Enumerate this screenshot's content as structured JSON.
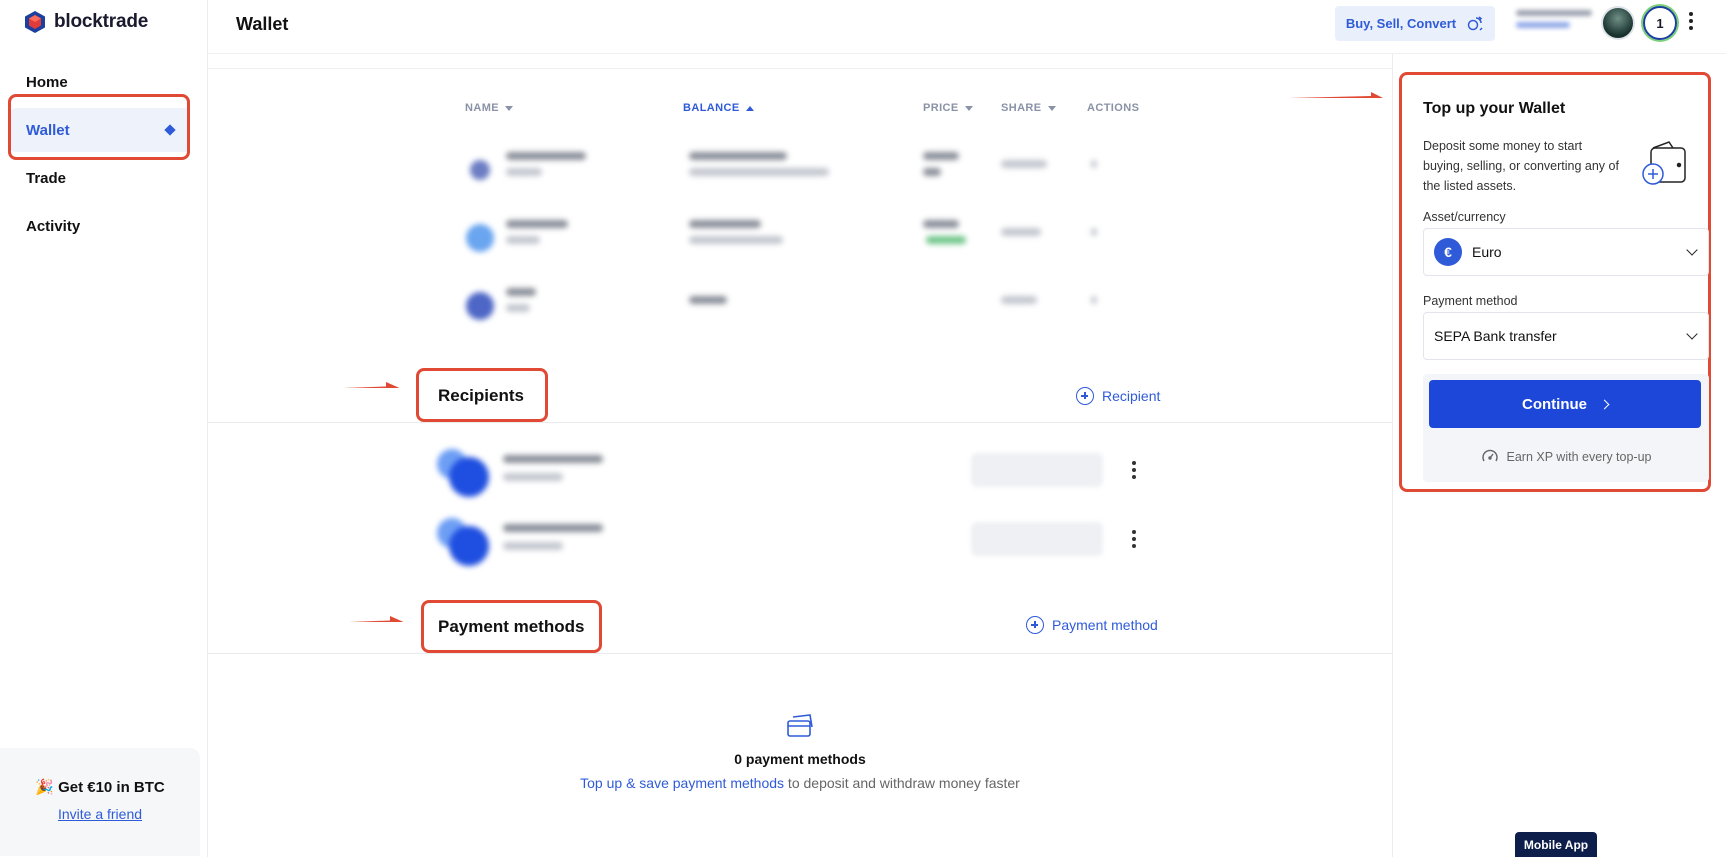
{
  "app": {
    "brand": "blocktrade"
  },
  "sidebar": {
    "items": [
      {
        "label": "Home"
      },
      {
        "label": "Wallet",
        "active": true
      },
      {
        "label": "Trade"
      },
      {
        "label": "Activity"
      }
    ],
    "promo": {
      "title": "🎉 Get €10 in BTC",
      "link": "Invite a friend"
    }
  },
  "header": {
    "title": "Wallet",
    "action_button": "Buy, Sell, Convert",
    "level": "1",
    "icons": [
      "exchange-icon",
      "avatar",
      "kebab-icon"
    ]
  },
  "assets_table": {
    "columns": [
      "NAME",
      "BALANCE",
      "PRICE",
      "SHARE",
      "ACTIONS"
    ],
    "sorted_column": "BALANCE",
    "sort_direction": "ascending"
  },
  "recipients": {
    "heading": "Recipients",
    "add_label": "Recipient"
  },
  "payment_methods": {
    "heading": "Payment methods",
    "add_label": "Payment method",
    "empty_title": "0 payment methods",
    "empty_link": "Top up & save payment methods",
    "empty_rest": " to deposit and withdraw money faster"
  },
  "topup": {
    "title": "Top up your Wallet",
    "description": "Deposit some money to start buying, selling, or converting any of the listed assets.",
    "asset_label": "Asset/currency",
    "asset_value": "Euro",
    "asset_symbol": "€",
    "payment_label": "Payment method",
    "payment_value": "SEPA Bank transfer",
    "continue": "Continue",
    "xp_note": "Earn XP with every top-up"
  },
  "mobile_app": "Mobile App",
  "colors": {
    "accent": "#2f5bd8",
    "primary_button": "#1c47d9",
    "annotation": "#e04a35"
  }
}
